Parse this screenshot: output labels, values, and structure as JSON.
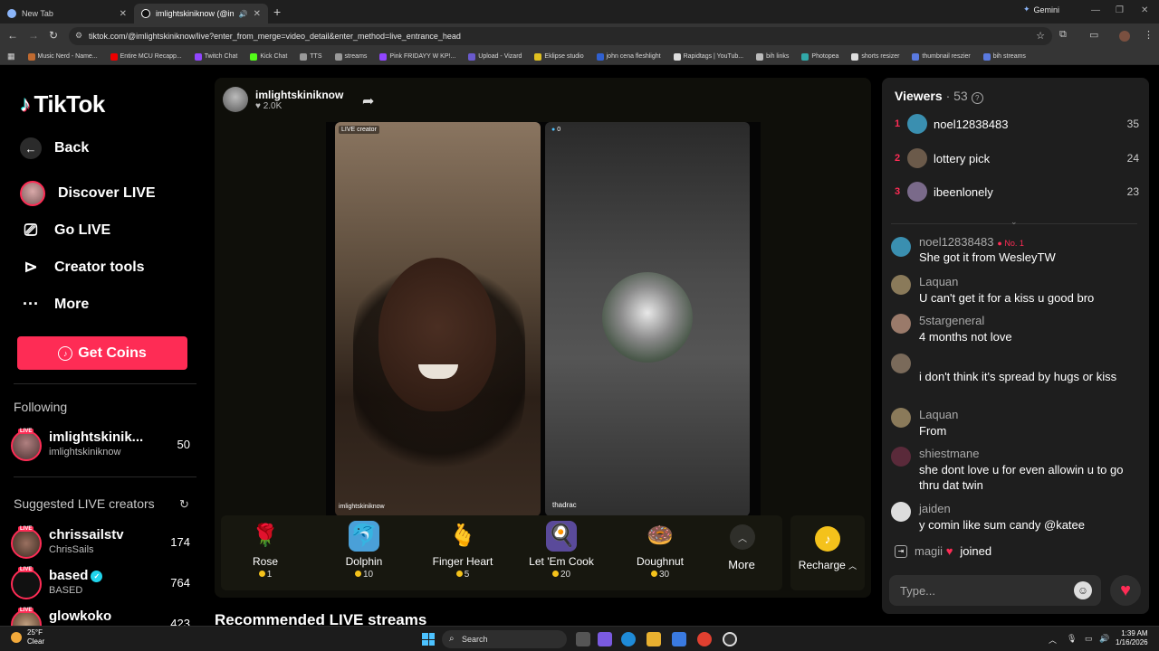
{
  "browser": {
    "tabs": [
      {
        "label": "New Tab",
        "active": false
      },
      {
        "label": "imlightskiniknow (@imlight",
        "active": true
      }
    ],
    "gemini_label": "Gemini",
    "url": "tiktok.com/@imlightskiniknow/live?enter_from_merge=video_detail&enter_method=live_entrance_head",
    "bookmarks": [
      "Music Nerd - Name...",
      "Entire MCU Recapp...",
      "Twitch Chat",
      "Kick Chat",
      "TTS",
      "streams",
      "Pink FRIDAYY W KP!...",
      "Upload - Vizard",
      "Eklipse studio",
      "john cena fleshlight",
      "Rapidtags | YouTub...",
      "bih links",
      "Photopea",
      "shorts resizer",
      "thumbnail reszier",
      "bih streams"
    ]
  },
  "sidebar": {
    "logo": "TikTok",
    "back": "Back",
    "nav": [
      {
        "label": "Discover LIVE",
        "icon": "avatar-icon"
      },
      {
        "label": "Go LIVE",
        "icon": "camera-icon"
      },
      {
        "label": "Creator tools",
        "icon": "creator-tools-icon"
      },
      {
        "label": "More",
        "icon": "more-dots-icon"
      }
    ],
    "get_coins": "Get Coins",
    "following_title": "Following",
    "following": [
      {
        "name": "imlightskinik...",
        "handle": "imlightskiniknow",
        "count": "50",
        "live": "LIVE"
      }
    ],
    "suggested_title": "Suggested LIVE creators",
    "suggested": [
      {
        "name": "chrissailstv",
        "handle": "ChrisSails",
        "count": "174",
        "live": "LIVE",
        "verified": false
      },
      {
        "name": "based",
        "handle": "BASED",
        "count": "764",
        "live": "LIVE",
        "verified": true
      },
      {
        "name": "glowkoko",
        "handle": "",
        "count": "423",
        "live": "LIVE",
        "verified": false
      }
    ]
  },
  "stream": {
    "host_name": "imlightskiniknow",
    "host_likes": "2.0K",
    "left_badge": "LIVE creator",
    "left_name": "imlightskiniknow",
    "right_badge": "0",
    "right_name": "thadrac"
  },
  "gifts": [
    {
      "name": "Rose",
      "price": "1",
      "icon": "🌹"
    },
    {
      "name": "Dolphin",
      "price": "10",
      "icon": "🐬"
    },
    {
      "name": "Finger Heart",
      "price": "5",
      "icon": "🫰"
    },
    {
      "name": "Let 'Em Cook",
      "price": "20",
      "icon": "🍳"
    },
    {
      "name": "Doughnut",
      "price": "30",
      "icon": "🍩"
    }
  ],
  "gift_more": "More",
  "recharge": "Recharge",
  "recommended_title": "Recommended LIVE streams",
  "viewers": {
    "title": "Viewers",
    "count": "53",
    "top": [
      {
        "rank": "1",
        "name": "noel12838483",
        "score": "35",
        "rank_color": "#fe2c55",
        "avatar_color": "#3a8fb0"
      },
      {
        "rank": "2",
        "name": "lottery pick",
        "score": "24",
        "rank_color": "#fe2c55",
        "avatar_color": "#6b5a4a"
      },
      {
        "rank": "3",
        "name": "ibeenlonely",
        "score": "23",
        "rank_color": "#fe2c55",
        "avatar_color": "#7a6a8a"
      }
    ]
  },
  "chat": [
    {
      "user": "noel12838483",
      "badge": "No. 1",
      "text": "She got it from WesleyTW",
      "avatar_color": "#3a8fb0"
    },
    {
      "user": "Laquan",
      "badge": "",
      "text": "U can't get it for a kiss u good bro",
      "avatar_color": "#8a7a5a"
    },
    {
      "user": "5stargeneral",
      "badge": "",
      "text": "4 months not love",
      "avatar_color": "#9a7a6a"
    },
    {
      "user": "",
      "badge": "",
      "text": "i don't think it's spread by hugs or kiss",
      "avatar_color": "#7a6a5a"
    },
    {
      "user": "Laquan",
      "badge": "",
      "text": "From",
      "avatar_color": "#8a7a5a"
    },
    {
      "user": "shiestmane",
      "badge": "",
      "text": "she dont love u for even allowin u to go thru dat twin",
      "avatar_color": "#5a2a3a"
    },
    {
      "user": "jaiden",
      "badge": "",
      "text": "y comin like sum candy @katee",
      "avatar_color": "#dddddd"
    }
  ],
  "joined": {
    "user": "magii",
    "text": "joined"
  },
  "chat_placeholder": "Type...",
  "taskbar": {
    "temp": "25°F",
    "weather": "Clear",
    "search": "Search",
    "time": "1:39 AM",
    "date": "1/16/2026"
  }
}
